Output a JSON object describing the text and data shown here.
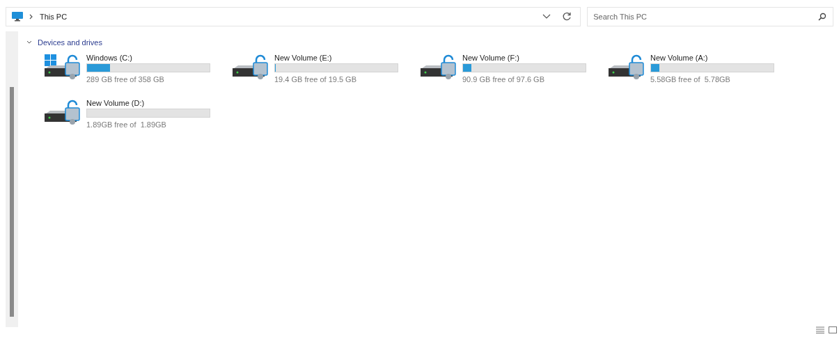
{
  "address_bar": {
    "location": "This PC"
  },
  "search": {
    "placeholder": "Search This PC"
  },
  "section": {
    "title": "Devices and drives",
    "expanded": true
  },
  "drives": [
    {
      "name": "Windows (C:)",
      "kind": "system",
      "level": 0.19,
      "free_text": "289 GB free of 358 GB"
    },
    {
      "name": "New Volume (E:)",
      "kind": "volume",
      "level": 0.005,
      "free_text": "19.4 GB free of 19.5 GB"
    },
    {
      "name": "New Volume (F:)",
      "kind": "volume",
      "level": 0.07,
      "free_text": "90.9 GB free of 97.6 GB"
    },
    {
      "name": "New Volume (A:)",
      "kind": "volume",
      "level": 0.07,
      "free_text": "5.58GB free of  5.78GB"
    },
    {
      "name": "New Volume (D:)",
      "kind": "volume",
      "free_text": "1.89GB free of  1.89GB"
    }
  ]
}
